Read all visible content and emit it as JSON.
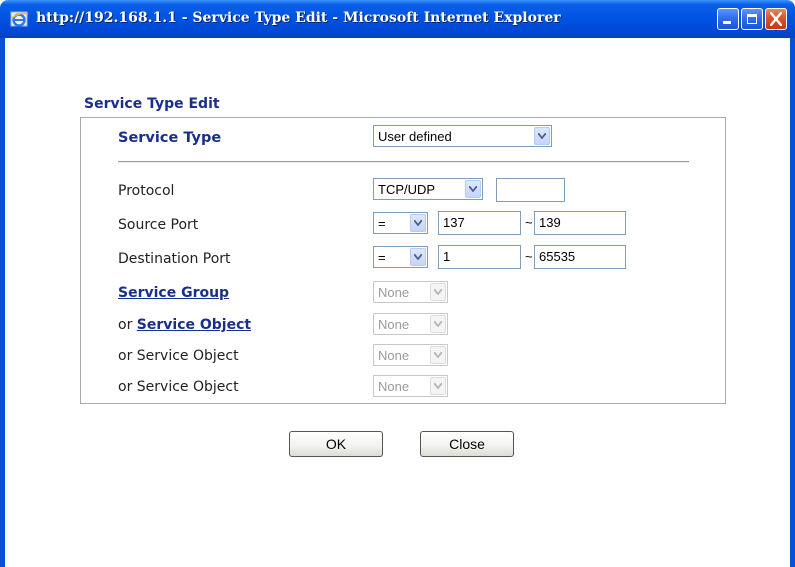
{
  "window": {
    "title": "http://192.168.1.1 - Service Type Edit - Microsoft Internet Explorer"
  },
  "form": {
    "title": "Service Type Edit",
    "service_type": {
      "label": "Service Type",
      "value": "User defined"
    },
    "protocol": {
      "label": "Protocol",
      "value": "TCP/UDP",
      "number": ""
    },
    "source_port": {
      "label": "Source Port",
      "operator": "=",
      "start": "137",
      "tilde": "~",
      "end": "139"
    },
    "destination_port": {
      "label": "Destination Port",
      "operator": "=",
      "start": "1",
      "tilde": "~",
      "end": "65535"
    },
    "service_group": {
      "label": "Service Group",
      "value": "None"
    },
    "service_object_1": {
      "prefix": "or",
      "label": "Service Object",
      "value": "None"
    },
    "service_object_2": {
      "label": "or Service Object",
      "value": "None"
    },
    "service_object_3": {
      "label": "or Service Object",
      "value": "None"
    }
  },
  "buttons": {
    "ok": "OK",
    "close": "Close"
  },
  "colors": {
    "titlebar": "#0054e3",
    "heading": "#1a2f8a",
    "close_button": "#d9542c"
  },
  "icons": [
    "ie-icon",
    "minimize-icon",
    "maximize-icon",
    "close-icon",
    "chevron-down-icon"
  ]
}
